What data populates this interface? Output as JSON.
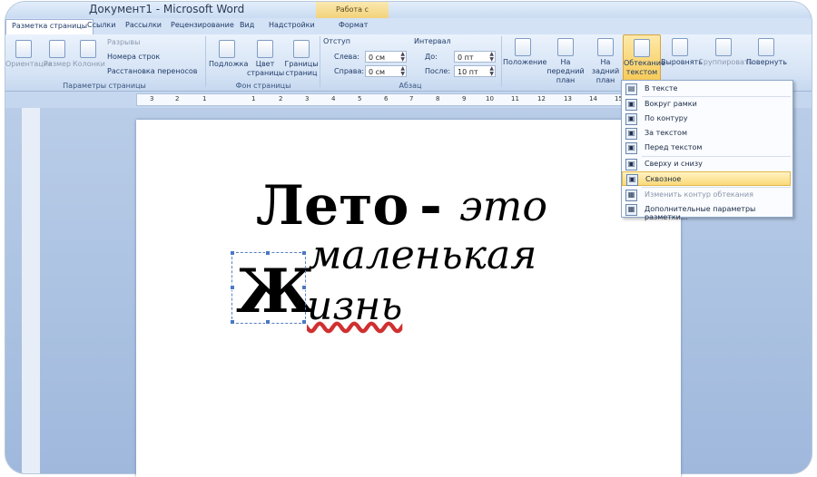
{
  "window": {
    "title": "Документ1 - Microsoft Word",
    "context_group": "Работа с надписями"
  },
  "tabs": [
    {
      "label": "Разметка страницы"
    },
    {
      "label": "Ссылки"
    },
    {
      "label": "Рассылки"
    },
    {
      "label": "Рецензирование"
    },
    {
      "label": "Вид"
    },
    {
      "label": "Надстройки"
    },
    {
      "label": "Формат"
    }
  ],
  "ribbon": {
    "page_setup": {
      "label": "Параметры страницы",
      "orientation": "Ориентация",
      "size": "Размер",
      "columns": "Колонки",
      "breaks": "Разрывы",
      "line_numbers": "Номера строк",
      "hyphenation": "Расстановка переносов"
    },
    "page_background": {
      "label": "Фон страницы",
      "watermark": "Подложка",
      "color_line1": "Цвет",
      "color_line2": "страницы",
      "borders_line1": "Границы",
      "borders_line2": "страниц"
    },
    "paragraph": {
      "label": "Абзац",
      "indent": "Отступ",
      "left_label": "Слева:",
      "left_value": "0 см",
      "right_label": "Справа:",
      "right_value": "0 см",
      "spacing": "Интервал",
      "before_label": "До:",
      "before_value": "0 пт",
      "after_label": "После:",
      "after_value": "10 пт"
    },
    "arrange": {
      "position": "Положение",
      "front_line1": "На передний",
      "front_line2": "план",
      "back_line1": "На задний",
      "back_line2": "план",
      "wrap_line1": "Обтекание",
      "wrap_line2": "текстом",
      "align": "Выровнять",
      "group": "Группировать",
      "rotate": "Повернуть"
    }
  },
  "ruler": [
    "3",
    "2",
    "1",
    "1",
    "2",
    "3",
    "4",
    "5",
    "6",
    "7",
    "8",
    "9",
    "10",
    "11",
    "12",
    "13",
    "14",
    "15"
  ],
  "wrap_menu": {
    "items": [
      {
        "label": "В тексте",
        "icon": "inline-icon"
      },
      {
        "label": "Вокруг рамки",
        "icon": "square-wrap-icon"
      },
      {
        "label": "По контуру",
        "icon": "tight-wrap-icon"
      },
      {
        "label": "За текстом",
        "icon": "behind-text-icon"
      },
      {
        "label": "Перед текстом",
        "icon": "in-front-icon"
      },
      {
        "label": "Сверху и снизу",
        "icon": "top-bottom-icon"
      },
      {
        "label": "Сквозное",
        "icon": "through-wrap-icon",
        "selected": true
      },
      {
        "label": "Изменить контур обтекания",
        "icon": "edit-wrap-points-icon",
        "disabled": true
      },
      {
        "label": "Дополнительные параметры разметки...",
        "icon": "more-layout-icon"
      }
    ]
  },
  "document": {
    "line1_bold": "Лето",
    "line1_dash": "-",
    "line1_rest": "это",
    "line2": "маленькая",
    "drop_letter": "Ж",
    "line3_rest": "изнь"
  },
  "colors": {
    "selected_menu": "#fbd979",
    "workspace": "#a9c0e2"
  }
}
